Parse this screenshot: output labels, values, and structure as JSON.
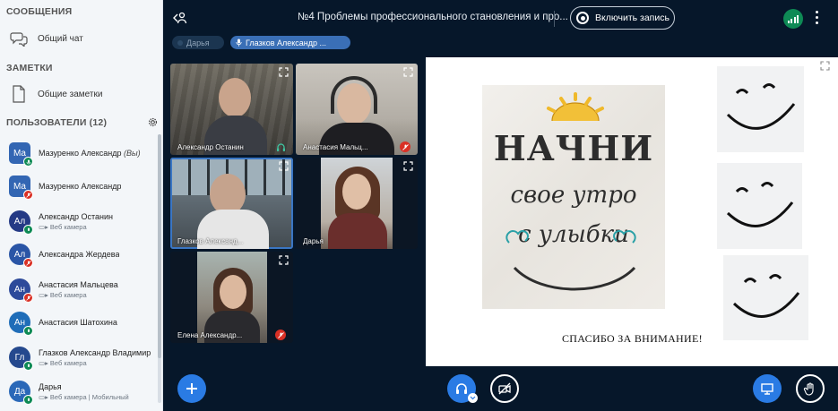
{
  "sidebar": {
    "messages_title": "СООБЩЕНИЯ",
    "public_chat": "Общий чат",
    "notes_title": "ЗАМЕТКИ",
    "shared_notes": "Общие заметки",
    "users_title": "ПОЛЬЗОВАТЕЛИ (12)",
    "users": [
      {
        "initials": "Ма",
        "name": "Мазуренко Александр",
        "you": "(Вы)",
        "sub": "",
        "color": "#3366b3"
      },
      {
        "initials": "Ма",
        "name": "Мазуренко Александр",
        "sub": "",
        "color": "#3366b3"
      },
      {
        "initials": "Ал",
        "name": "Александр Останин",
        "sub": "Веб камера",
        "color": "#243a85"
      },
      {
        "initials": "Ал",
        "name": "Александра Жердева",
        "sub": "",
        "color": "#2a55a6"
      },
      {
        "initials": "Ан",
        "name": "Анастасия Мальцева",
        "sub": "Веб камера",
        "color": "#2d4a9a"
      },
      {
        "initials": "Ан",
        "name": "Анастасия Шатохина",
        "sub": "",
        "color": "#1f6db8"
      },
      {
        "initials": "Гл",
        "name": "Глазков Александр Владимир",
        "sub": "Веб камера",
        "color": "#25498e"
      },
      {
        "initials": "Да",
        "name": "Дарья",
        "sub": "Веб камера | Мобильный",
        "color": "#2a68b8"
      }
    ]
  },
  "topbar": {
    "title": "№4 Проблемы профессионального становления и про...",
    "record_label": "Включить запись"
  },
  "talkers": {
    "inactive": "Дарья",
    "active": "Глазков Александр ..."
  },
  "tiles": {
    "t1": "Александр Останин",
    "t2": "Анастасия Мальц...",
    "t3": "Глазков Александ...",
    "t4": "Дарья",
    "t5": "Елена Александр..."
  },
  "presentation": {
    "poster_line1": "НАЧНИ",
    "poster_line2": "свое утро",
    "poster_line3": "с улыбки",
    "thanks": "СПАСИБО ЗА ВНИМАНИЕ!"
  },
  "colors": {
    "accent": "#2a7be4",
    "muted": "#d93025",
    "connected": "#0e8a55",
    "background": "#06172a"
  }
}
